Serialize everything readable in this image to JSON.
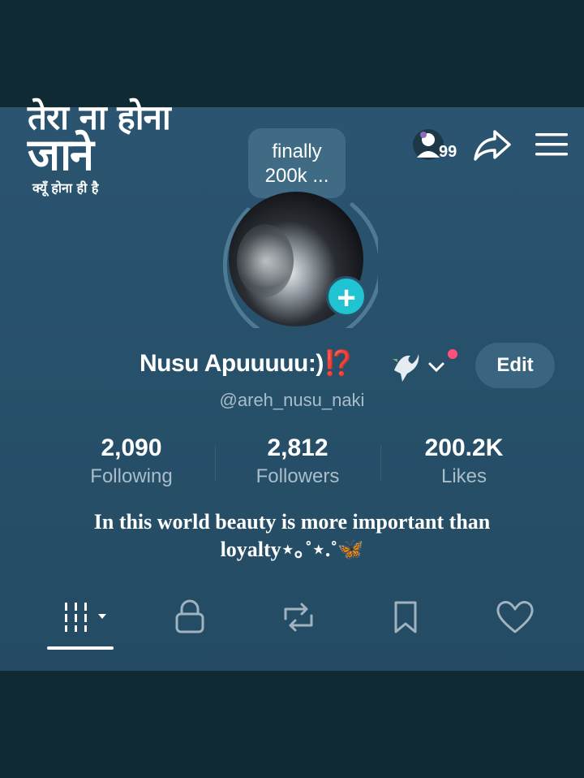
{
  "overlay": {
    "line1": "तेरा ना होना",
    "line2": "जाने",
    "line3": "क्यूँ होना ही है"
  },
  "header": {
    "story_count": "99",
    "icons": [
      "stories-avatar-icon",
      "share-icon",
      "menu-icon"
    ]
  },
  "profile": {
    "bubble_line1": "finally",
    "bubble_line2": "200k ...",
    "name": "Nusu Apuuuuu:)",
    "name_emoji": "⁉️",
    "edit_label": "Edit",
    "handle": "@areh_nusu_naki",
    "accent_color": "#20c3d2"
  },
  "stats": [
    {
      "value": "2,090",
      "label": "Following"
    },
    {
      "value": "2,812",
      "label": "Followers"
    },
    {
      "value": "200.2K",
      "label": "Likes"
    }
  ],
  "bio": {
    "line1": "In this world beauty is more important than",
    "line2": "loyalty⋆｡˚⋆.˚🦋"
  },
  "tabs": [
    "videos-grid-icon",
    "lock-icon",
    "repost-icon",
    "bookmark-icon",
    "heart-icon"
  ]
}
